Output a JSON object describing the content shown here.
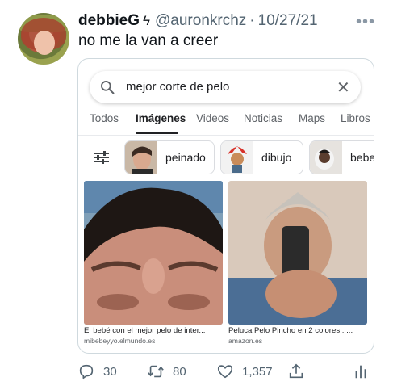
{
  "tweet": {
    "display_name": "debbieG",
    "verified_glyph": "ϟ",
    "handle": "@auronkrchz",
    "separator": "·",
    "date": "10/27/21",
    "more_icon": "more-icon",
    "more_glyph": "•••",
    "text": "no me la van a creer"
  },
  "screenshot_card": {
    "search": {
      "query": "mejor corte de pelo",
      "search_icon": "search-icon",
      "clear_icon": "close-icon",
      "clear_glyph": "✕"
    },
    "tabs": [
      {
        "label": "Todos",
        "active": false
      },
      {
        "label": "Imágenes",
        "active": true
      },
      {
        "label": "Videos",
        "active": false
      },
      {
        "label": "Noticias",
        "active": false
      },
      {
        "label": "Maps",
        "active": false
      },
      {
        "label": "Libros",
        "active": false
      }
    ],
    "filter_icon": "tune-icon",
    "chips": [
      {
        "label": "peinado"
      },
      {
        "label": "dibujo"
      },
      {
        "label": "bebe"
      }
    ],
    "results": [
      {
        "title": "El bebé con el mejor pelo de inter...",
        "source": "mibebeyyo.elmundo.es"
      },
      {
        "title": "Peluca Pelo Pincho en 2 colores : ...",
        "source": "amazon.es"
      }
    ]
  },
  "actions": {
    "replies": "30",
    "retweets": "80",
    "likes": "1,357"
  },
  "colors": {
    "text_primary": "#0f1419",
    "text_secondary": "#536471",
    "card_border": "#cfd9de"
  }
}
